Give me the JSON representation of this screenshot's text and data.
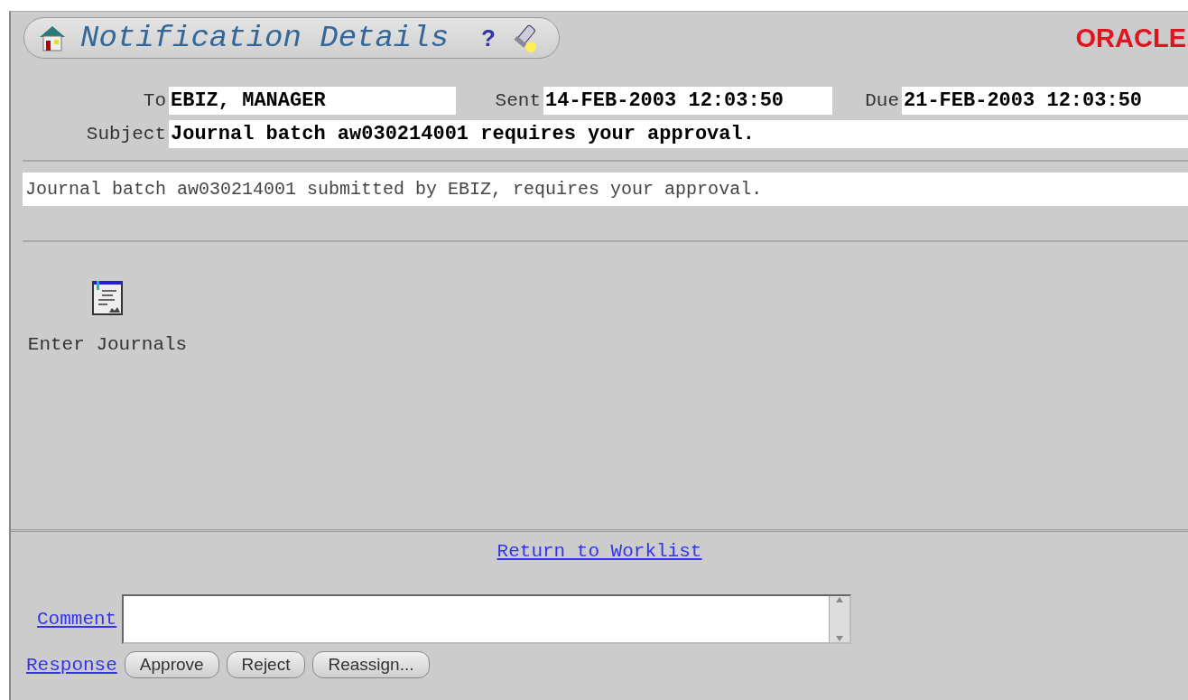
{
  "header": {
    "title": "Notification Details",
    "help": "?",
    "logo": "ORACLE"
  },
  "fields": [
    {
      "label": "To",
      "value": "EBIZ, MANAGER"
    },
    {
      "label": "Sent",
      "value": "14-FEB-2003 12:03:50"
    },
    {
      "label": "Due",
      "value": "21-FEB-2003 12:03:50"
    }
  ],
  "subject": {
    "label": "Subject",
    "value": "Journal batch aw030214001 requires your approval."
  },
  "message": "Journal batch aw030214001 submitted by EBIZ, requires your approval.",
  "attachments": [
    {
      "label": "Enter Journals"
    }
  ],
  "return_link": "Return to Worklist",
  "comment": {
    "label": "Comment"
  },
  "response": {
    "label": "Response",
    "buttons": [
      "Approve",
      "Reject",
      "Reassign..."
    ]
  }
}
